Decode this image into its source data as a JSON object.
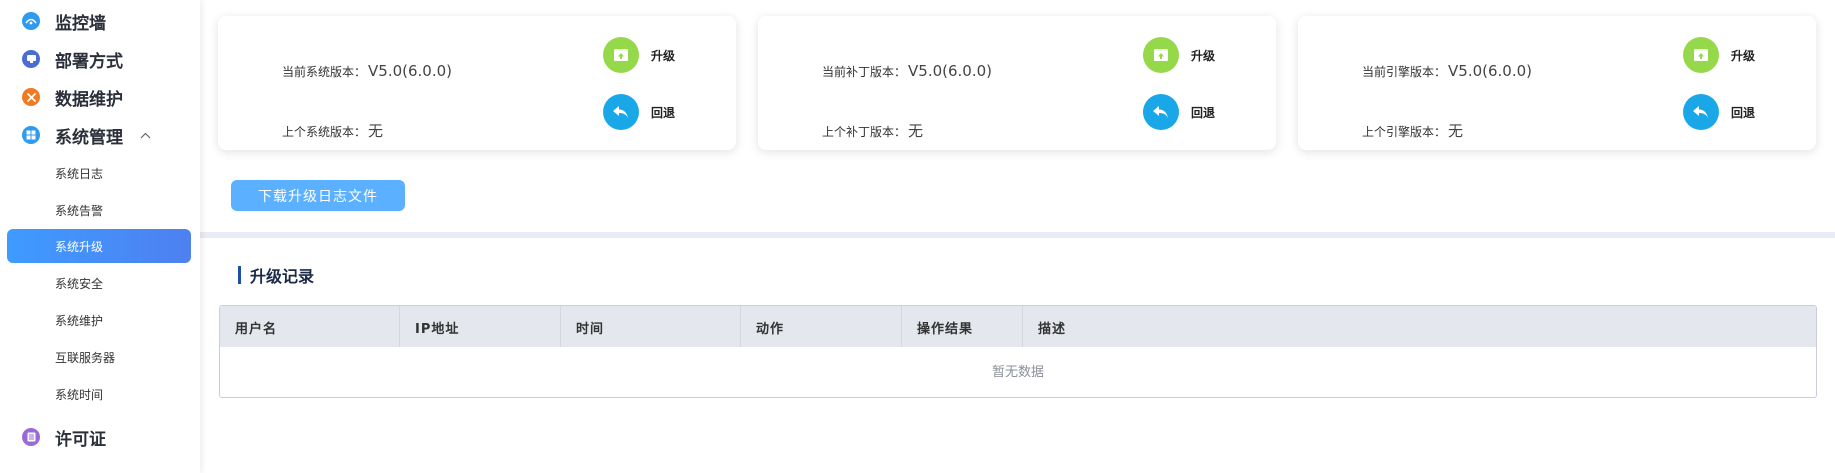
{
  "sidebar": {
    "menu": [
      {
        "label": "监控墙",
        "icon": "monitor-wall-icon",
        "color": "#2e9bf0"
      },
      {
        "label": "部署方式",
        "icon": "deploy-icon",
        "color": "#4a6cd4"
      },
      {
        "label": "数据维护",
        "icon": "tools-icon",
        "color": "#f07a24"
      },
      {
        "label": "系统管理",
        "icon": "windows-icon",
        "color": "#2e9bf0",
        "expanded": true,
        "arrow": "^"
      },
      {
        "label": "许可证",
        "icon": "license-icon",
        "color": "#9a6ad8"
      }
    ],
    "sub": [
      {
        "label": "系统日志"
      },
      {
        "label": "系统告警"
      },
      {
        "label": "系统升级",
        "active": true
      },
      {
        "label": "系统安全"
      },
      {
        "label": "系统维护"
      },
      {
        "label": "互联服务器"
      },
      {
        "label": "系统时间"
      }
    ]
  },
  "cards": [
    {
      "current_label": "当前系统版本：",
      "current_value": "V5.0(6.0.0)",
      "previous_label": "上个系统版本：",
      "previous_value": "无",
      "upgrade": "升级",
      "rollback": "回退"
    },
    {
      "current_label": "当前补丁版本：",
      "current_value": "V5.0(6.0.0)",
      "previous_label": "上个补丁版本：",
      "previous_value": "无",
      "upgrade": "升级",
      "rollback": "回退"
    },
    {
      "current_label": "当前引擎版本：",
      "current_value": "V5.0(6.0.0)",
      "previous_label": "上个引擎版本：",
      "previous_value": "无",
      "upgrade": "升级",
      "rollback": "回退"
    }
  ],
  "download_button": "下载升级日志文件",
  "records": {
    "title": "升级记录",
    "columns": [
      "用户名",
      "IP地址",
      "时间",
      "动作",
      "操作结果",
      "描述"
    ],
    "empty_text": "暂无数据"
  },
  "colors": {
    "upgrade": "#95d84a",
    "rollback": "#1aa7e8",
    "accent": "#3e9bff"
  }
}
